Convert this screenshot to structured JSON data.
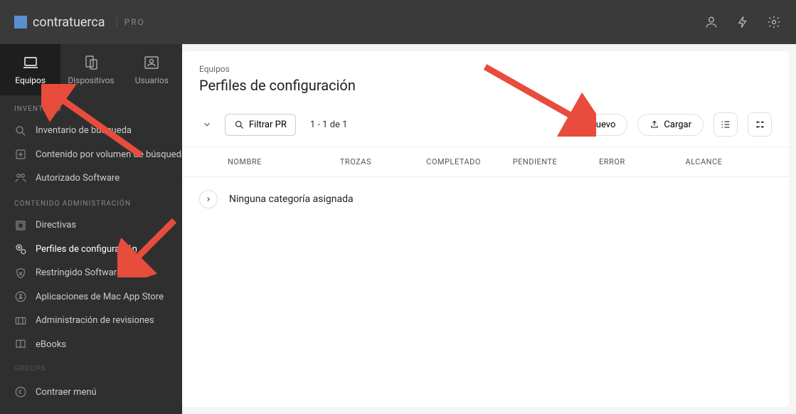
{
  "brand": {
    "name": "contratuerca",
    "sub": "PRO"
  },
  "tabs": [
    {
      "label": "Equipos",
      "active": true
    },
    {
      "label": "Dispositivos",
      "active": false
    },
    {
      "label": "Usuarios",
      "active": false
    }
  ],
  "sections": {
    "inventory": {
      "header": "INVENTARIO",
      "items": [
        {
          "label": "Inventario de búsqueda"
        },
        {
          "label": "Contenido por volumen de búsqueda"
        },
        {
          "label": "Autorizado  Software"
        }
      ]
    },
    "content": {
      "header": "CONTENIDO  ADMINISTRACIÓN",
      "items": [
        {
          "label": "Directivas"
        },
        {
          "label": "Perfiles de configuración",
          "active": true
        },
        {
          "label": "Restringido  Software"
        },
        {
          "label": "Aplicaciones de Mac App Store"
        },
        {
          "label": "Administración de revisiones"
        },
        {
          "label": "eBooks"
        }
      ]
    },
    "groups": {
      "header": "GROUPS"
    }
  },
  "collapse_label": "Contraer menú",
  "main": {
    "breadcrumb": "Equipos",
    "title": "Perfiles de configuración",
    "filter_label": "Filtrar PR",
    "count": "1 - 1 de 1",
    "new_label": "Nuevo",
    "upload_label": "Cargar",
    "columns": [
      "NOMBRE",
      "TROZAS",
      "COMPLETADO",
      "PENDIENTE",
      "ERROR",
      "ALCANCE"
    ],
    "category_row": "Ninguna categoría asignada"
  }
}
